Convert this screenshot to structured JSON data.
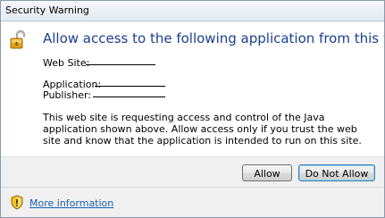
{
  "window": {
    "title": "Security Warning"
  },
  "dialog": {
    "heading": "Allow access to the following application from this web site?",
    "fields": {
      "website_label": "Web Site:",
      "website_value": "",
      "application_label": "Application:",
      "application_value": "",
      "publisher_label": "Publisher:",
      "publisher_value": ""
    },
    "description": "This web site is requesting access and control of the Java application shown above. Allow access only if you trust the web site and know that the application is intended to run on this site."
  },
  "buttons": {
    "allow_label": "Allow",
    "do_not_allow_label": "Do Not Allow"
  },
  "footer": {
    "more_information_label": "More information"
  },
  "icons": {
    "lock": "unlocked-padlock-icon",
    "shield": "warning-shield-icon"
  },
  "colors": {
    "heading": "#1b3f8f",
    "link": "#1a5fb4",
    "footer_bg": "#f0f0f0"
  }
}
